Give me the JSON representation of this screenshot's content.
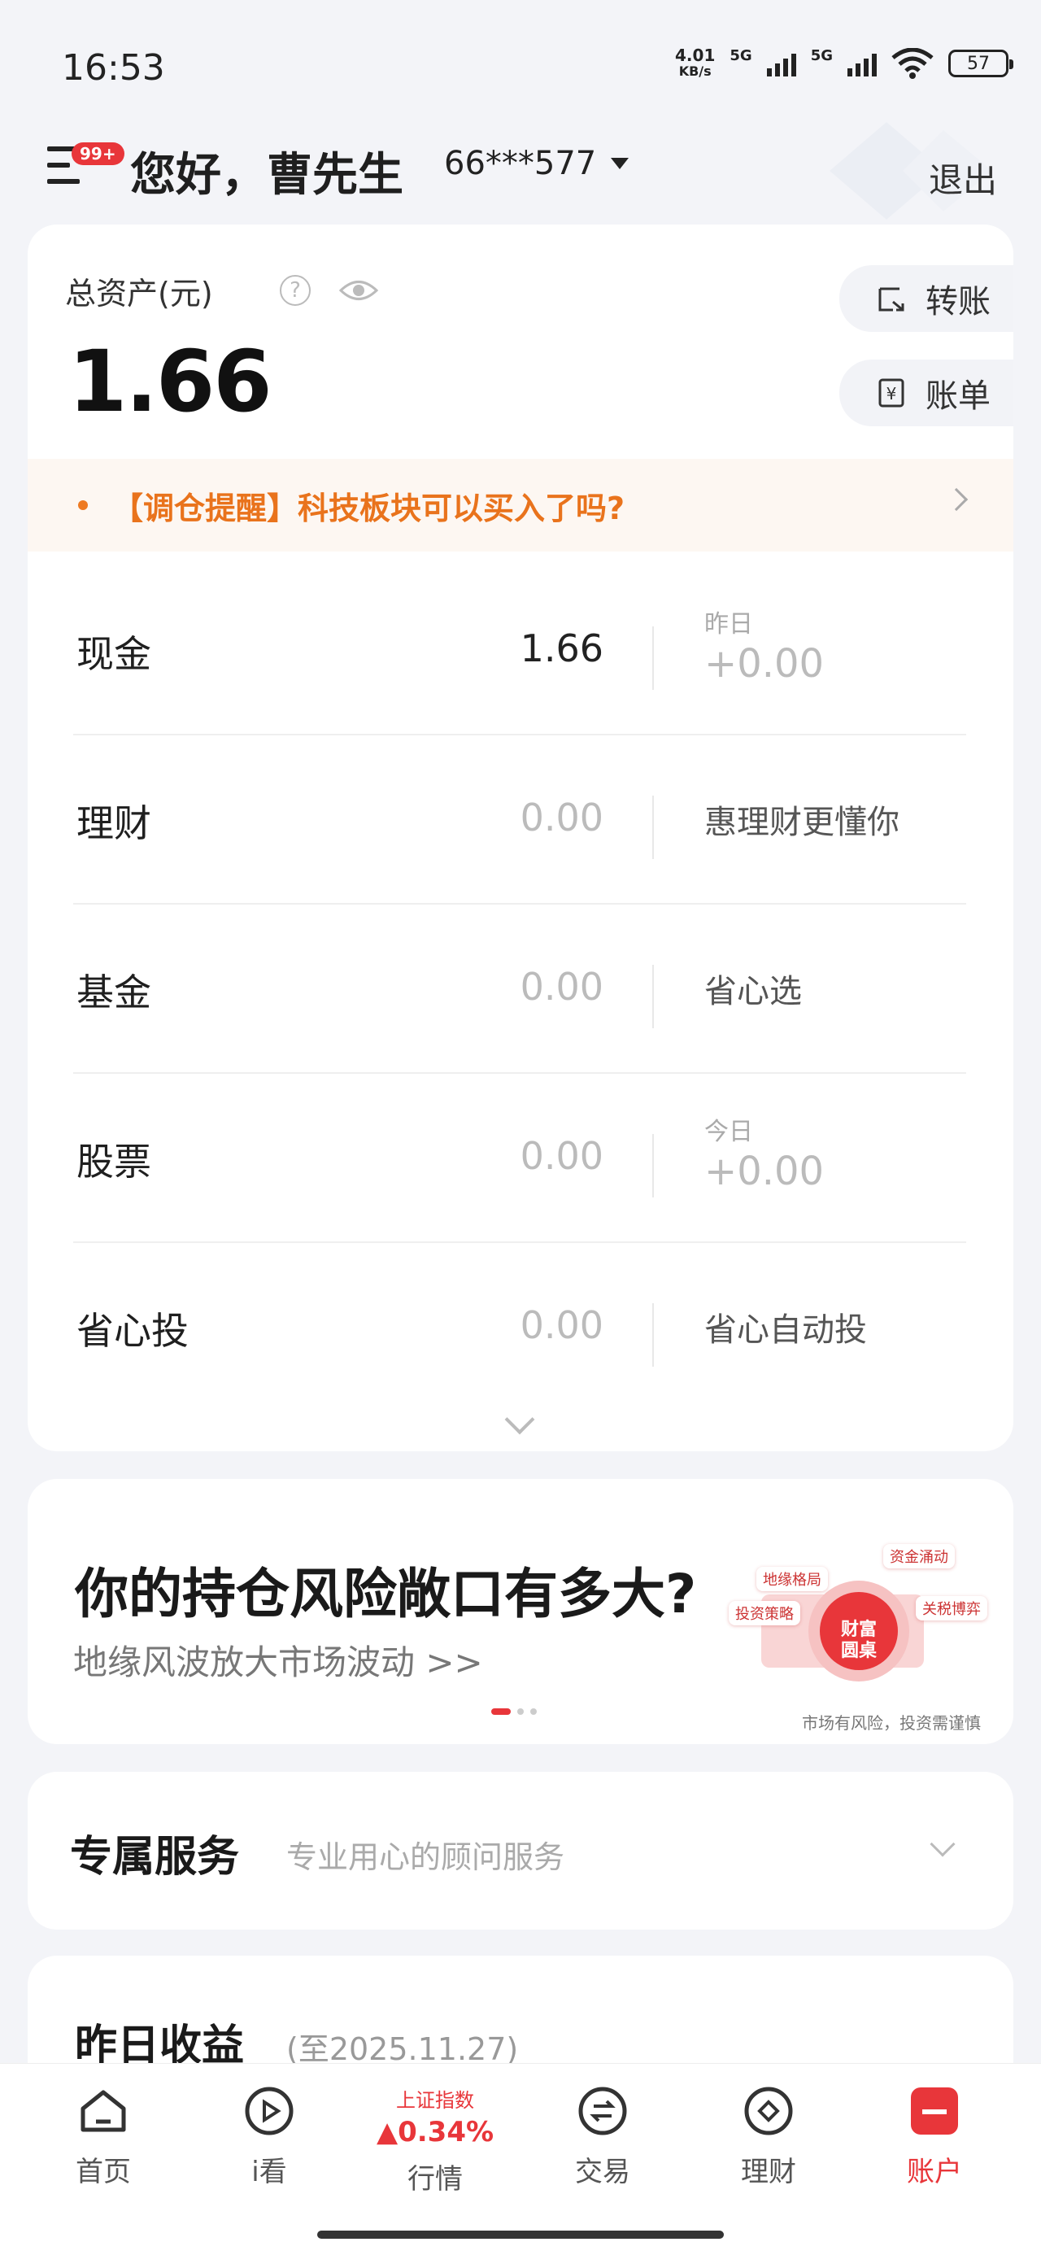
{
  "status_bar": {
    "time": "16:53",
    "speed_value": "4.01",
    "speed_unit": "KB/s",
    "net1": "5G",
    "net2": "5G",
    "battery": "57"
  },
  "header": {
    "badge": "99+",
    "greeting": "您好，曹先生",
    "account": "66***577",
    "logout": "退出"
  },
  "assets": {
    "label": "总资产(元)",
    "value": "1.66",
    "transfer": "转账",
    "bill": "账单",
    "reminder": "【调仓提醒】科技板块可以买入了吗?",
    "rows": [
      {
        "label": "现金",
        "value": "1.66",
        "sub": "昨日",
        "note": "+0.00"
      },
      {
        "label": "理财",
        "value": "0.00",
        "note": "惠理财更懂你"
      },
      {
        "label": "基金",
        "value": "0.00",
        "note": "省心选"
      },
      {
        "label": "股票",
        "value": "0.00",
        "sub": "今日",
        "note": "+0.00"
      },
      {
        "label": "省心投",
        "value": "0.00",
        "note": "省心自动投"
      }
    ]
  },
  "banner": {
    "title": "你的持仓风险敞口有多大?",
    "subtitle": "地缘风波放大市场波动 >>",
    "tags": [
      "资金涌动",
      "地缘格局",
      "投资策略",
      "关税博弈"
    ],
    "art_text": "财富圆桌",
    "disclaimer": "市场有风险，投资需谨慎"
  },
  "service": {
    "title": "专属服务",
    "subtitle": "专业用心的顾问服务"
  },
  "yesterday": {
    "title": "昨日收益",
    "date": "(至2025.11.27)"
  },
  "tabbar": {
    "home": "首页",
    "watch": "i看",
    "market_index": "上证指数",
    "market_change": "▲0.34%",
    "market": "行情",
    "trade": "交易",
    "wealth": "理财",
    "account": "账户"
  },
  "colors": {
    "accent": "#e8363a",
    "reminder": "#e9731c"
  }
}
